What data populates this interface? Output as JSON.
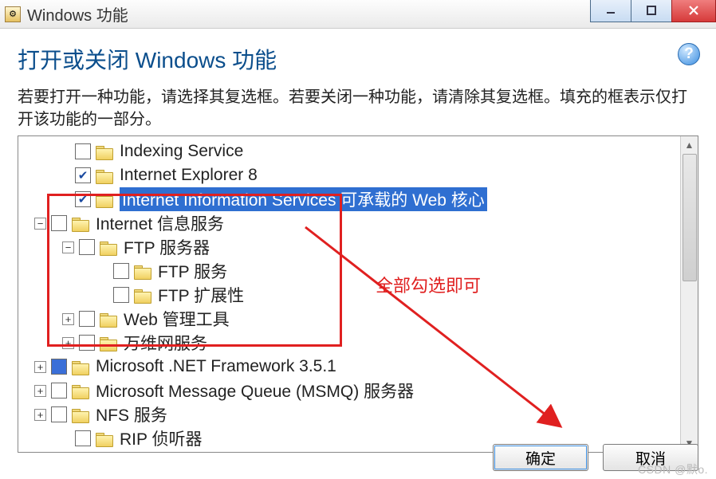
{
  "window": {
    "title": "Windows 功能"
  },
  "help_glyph": "?",
  "heading": "打开或关闭 Windows 功能",
  "description": "若要打开一种功能，请选择其复选框。若要关闭一种功能，请清除其复选框。填充的框表示仅打开该功能的一部分。",
  "tree": {
    "items": [
      {
        "indent": 50,
        "expander": "",
        "check": "none",
        "label": "Indexing Service"
      },
      {
        "indent": 50,
        "expander": "",
        "check": "checked",
        "label": "Internet Explorer 8"
      },
      {
        "indent": 50,
        "expander": "",
        "check": "checked",
        "label": "Internet Information Services 可承载的 Web 核心",
        "selected": true
      },
      {
        "indent": 20,
        "expander": "-",
        "check": "none",
        "label": "Internet 信息服务"
      },
      {
        "indent": 55,
        "expander": "-",
        "check": "none",
        "label": "FTP 服务器"
      },
      {
        "indent": 98,
        "expander": "",
        "check": "none",
        "label": "FTP 服务"
      },
      {
        "indent": 98,
        "expander": "",
        "check": "none",
        "label": "FTP 扩展性"
      },
      {
        "indent": 55,
        "expander": "+",
        "check": "none",
        "label": "Web 管理工具"
      },
      {
        "indent": 55,
        "expander": "+",
        "check": "none",
        "label": "万维网服务"
      },
      {
        "indent": 20,
        "expander": "+",
        "check": "filled",
        "label": "Microsoft .NET Framework 3.5.1"
      },
      {
        "indent": 20,
        "expander": "+",
        "check": "none",
        "label": "Microsoft Message Queue (MSMQ) 服务器"
      },
      {
        "indent": 20,
        "expander": "+",
        "check": "none",
        "label": "NFS 服务"
      },
      {
        "indent": 50,
        "expander": "",
        "check": "none",
        "label": "RIP 侦听器"
      }
    ]
  },
  "annotation": {
    "text": "全部勾选即可"
  },
  "buttons": {
    "ok": "确定",
    "cancel": "取消"
  },
  "watermark": "CSDN @默o."
}
